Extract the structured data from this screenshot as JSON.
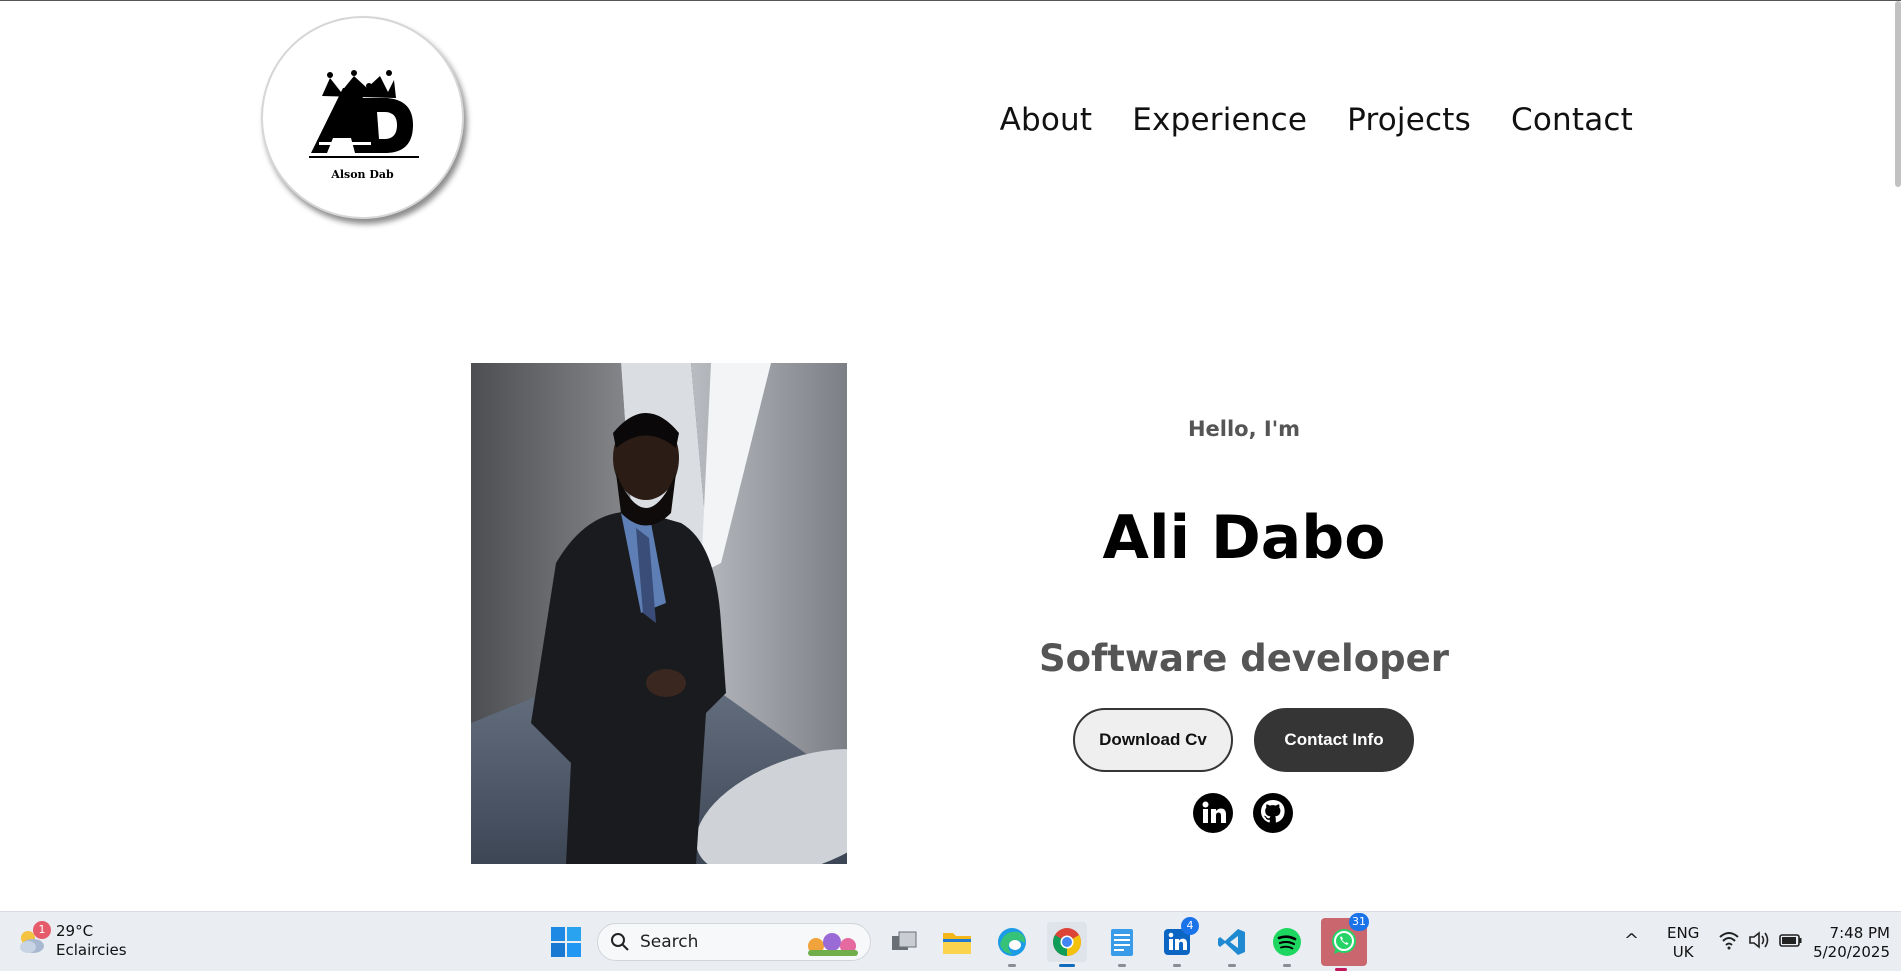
{
  "logo": {
    "alt_text": "Alson Dab"
  },
  "nav": {
    "items": [
      "About",
      "Experience",
      "Projects",
      "Contact"
    ]
  },
  "hero": {
    "greeting": "Hello, I'm",
    "name": "Ali Dabo",
    "role": "Software developer",
    "download_label": "Download Cv",
    "contact_label": "Contact Info",
    "social_icons": [
      "linkedin-icon",
      "github-icon"
    ]
  },
  "taskbar": {
    "weather": {
      "temp": "29°C",
      "condition": "Eclaircies",
      "badge": "1"
    },
    "search_label": "Search",
    "apps": [
      {
        "name": "task-view",
        "badge": ""
      },
      {
        "name": "file-explorer",
        "badge": ""
      },
      {
        "name": "edge",
        "badge": ""
      },
      {
        "name": "chrome",
        "badge": ""
      },
      {
        "name": "notepad",
        "badge": ""
      },
      {
        "name": "linkedin",
        "badge": "4"
      },
      {
        "name": "vscode",
        "badge": ""
      },
      {
        "name": "spotify",
        "badge": ""
      },
      {
        "name": "whatsapp",
        "badge": "31"
      }
    ],
    "language_line1": "ENG",
    "language_line2": "UK",
    "time": "7:48 PM",
    "date": "5/20/2025"
  }
}
